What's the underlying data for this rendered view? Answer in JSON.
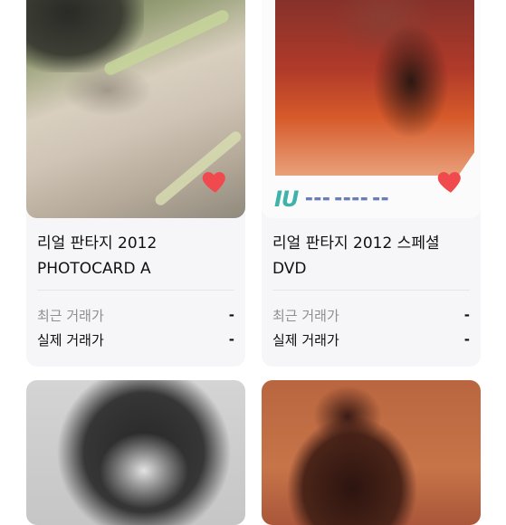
{
  "products": [
    {
      "title_line1": "리얼 판타지 2012",
      "title_line2": "PHOTOCARD A",
      "recent_price_label": "최근 거래가",
      "recent_price_value": "-",
      "actual_price_label": "실제 거래가",
      "actual_price_value": "-",
      "liked": true
    },
    {
      "title_line1": "리얼 판타지 2012 스페셜",
      "title_line2": "DVD",
      "recent_price_label": "최근 거래가",
      "recent_price_value": "-",
      "actual_price_label": "실제 거래가",
      "actual_price_value": "-",
      "liked": true,
      "cover_logo": "IU"
    },
    {
      "title_line1": "",
      "title_line2": ""
    },
    {
      "title_line1": "",
      "title_line2": ""
    }
  ],
  "colors": {
    "heart": "#f04a4f",
    "card_bg": "#f6f6f8",
    "muted_text": "#8e8e93"
  },
  "icons": {
    "like": "heart-icon"
  }
}
